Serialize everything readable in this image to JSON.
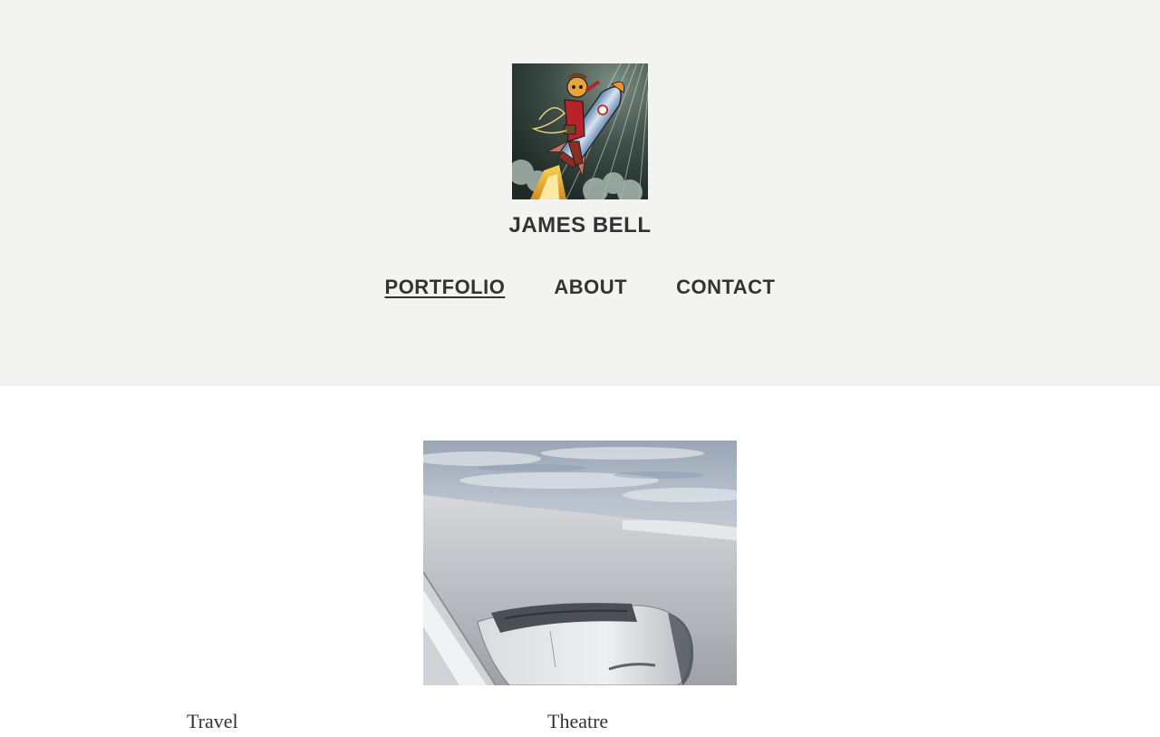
{
  "site": {
    "title": "JAMES BELL",
    "avatar_alt": "rocket-rider-avatar"
  },
  "nav": {
    "items": [
      {
        "label": "PORTFOLIO",
        "active": true
      },
      {
        "label": "ABOUT",
        "active": false
      },
      {
        "label": "CONTACT",
        "active": false
      }
    ]
  },
  "hero": {
    "alt": "view from airplane window of engine and clouds"
  },
  "gallery": {
    "labels": [
      "Travel",
      "Theatre"
    ]
  },
  "colors": {
    "header_bg": "#f3f3f2",
    "text": "#333333",
    "page_bg": "#ffffff"
  }
}
